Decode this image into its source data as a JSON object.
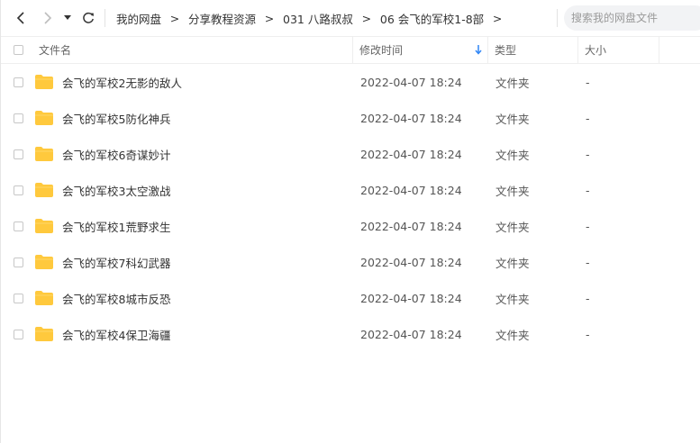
{
  "nav": {
    "back_icon": "chevron-left-icon",
    "forward_icon": "chevron-right-icon",
    "dropdown_icon": "caret-down-icon",
    "refresh_icon": "refresh-icon"
  },
  "breadcrumb": {
    "items": [
      "我的网盘",
      "分享教程资源",
      "031 八路叔叔",
      "06 会飞的军校1-8部"
    ],
    "separator": ">"
  },
  "search": {
    "placeholder": "搜索我的网盘文件",
    "value": ""
  },
  "table": {
    "headers": {
      "name": "文件名",
      "mtime": "修改时间",
      "type": "类型",
      "size": "大小"
    },
    "sort_icon": "arrow-down-icon",
    "sort_color": "#2f86f6",
    "folder_color": "#ffc93d",
    "rows": [
      {
        "name": "会飞的军校2无影的敌人",
        "mtime": "2022-04-07 18:24",
        "type": "文件夹",
        "size": "-"
      },
      {
        "name": "会飞的军校5防化神兵",
        "mtime": "2022-04-07 18:24",
        "type": "文件夹",
        "size": "-"
      },
      {
        "name": "会飞的军校6奇谋妙计",
        "mtime": "2022-04-07 18:24",
        "type": "文件夹",
        "size": "-"
      },
      {
        "name": "会飞的军校3太空激战",
        "mtime": "2022-04-07 18:24",
        "type": "文件夹",
        "size": "-"
      },
      {
        "name": "会飞的军校1荒野求生",
        "mtime": "2022-04-07 18:24",
        "type": "文件夹",
        "size": "-"
      },
      {
        "name": "会飞的军校7科幻武器",
        "mtime": "2022-04-07 18:24",
        "type": "文件夹",
        "size": "-"
      },
      {
        "name": "会飞的军校8城市反恐",
        "mtime": "2022-04-07 18:24",
        "type": "文件夹",
        "size": "-"
      },
      {
        "name": "会飞的军校4保卫海疆",
        "mtime": "2022-04-07 18:24",
        "type": "文件夹",
        "size": "-"
      }
    ]
  }
}
